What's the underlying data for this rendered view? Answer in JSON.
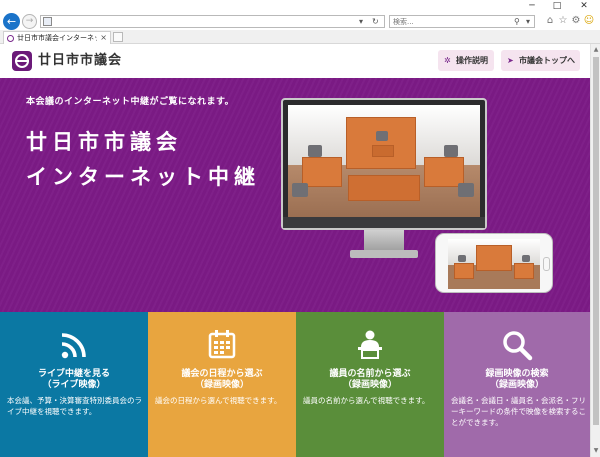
{
  "browser": {
    "tab_title": "廿日市市議会インターネット議...",
    "tab_close": "×",
    "search_placeholder": "検索...",
    "window_controls": [
      "─",
      "□",
      "✕"
    ]
  },
  "header": {
    "site_title": "廿日市市議会",
    "buttons": [
      {
        "label": "操作説明",
        "icon": "gear-icon"
      },
      {
        "label": "市議会トップへ",
        "icon": "chevron-icon"
      }
    ]
  },
  "hero": {
    "subtitle": "本会議のインターネット中継がご覧になれます。",
    "title_line1": "廿日市市議会",
    "title_line2": "インターネット中継"
  },
  "tiles": [
    {
      "icon": "wifi-icon",
      "title": "ライブ中継を見る",
      "sub": "（ライブ映像）",
      "desc": "本会議、予算・決算審査特別委員会のライブ中継を視聴できます。",
      "color": "#0b78a3"
    },
    {
      "icon": "calendar-icon",
      "title": "議会の日程から選ぶ",
      "sub": "（録画映像）",
      "desc": "議会の日程から選んで視聴できます。",
      "color": "#e8a53f"
    },
    {
      "icon": "speaker-icon",
      "title": "議員の名前から選ぶ",
      "sub": "（録画映像）",
      "desc": "議員の名前から選んで視聴できます。",
      "color": "#5a8e3a"
    },
    {
      "icon": "magnifier-icon",
      "title": "録画映像の検索",
      "sub": "（録画映像）",
      "desc": "会議名・会議日・議員名・会派名・フリーキーワードの条件で映像を検索することができます。",
      "color": "#a06aaa"
    }
  ],
  "colors": {
    "brand_purple": "#7c1b86",
    "header_button_bg": "#f5e4ef"
  }
}
